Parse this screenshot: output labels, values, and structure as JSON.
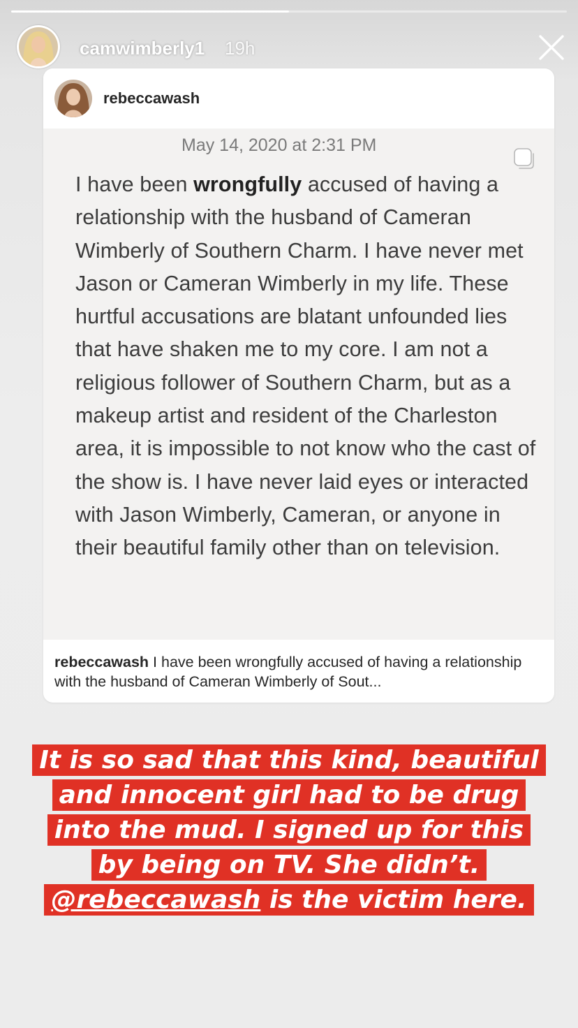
{
  "story": {
    "progress": 0.5,
    "username": "camwimberly1",
    "time_ago": "19h"
  },
  "post": {
    "username": "rebeccawash",
    "note_date": "May 14, 2020 at 2:31 PM",
    "note_body": {
      "before_bold": "I have been ",
      "bold": "wrongfully",
      "after_bold": " accused of having a relationship with the husband of Cameran Wimberly of Southern Charm. I have never met Jason or Cameran Wimberly in my life. These hurtful accusations are blatant unfounded lies that have shaken me to my core. I am not a religious follower of Southern Charm, but as a makeup artist and resident of the Charleston area, it is impossible to not know who the cast of the show is. I have never laid eyes or interacted with  Jason Wimberly, Cameran, or anyone in their beautiful family other than on television."
    },
    "caption_user": "rebeccawash",
    "caption_text": " I have been wrongfully accused of having a relationship with the husband of Cameran Wimberly of Sout..."
  },
  "overlay": {
    "lines": [
      "It is so sad that this kind, beautiful",
      "and innocent girl had to be drug",
      "into the mud. I signed up for this",
      "by being on TV. She didn’t."
    ],
    "mention": "@rebeccawash",
    "last_line_rest": " is the victim here.",
    "highlight_color": "#e03125"
  }
}
